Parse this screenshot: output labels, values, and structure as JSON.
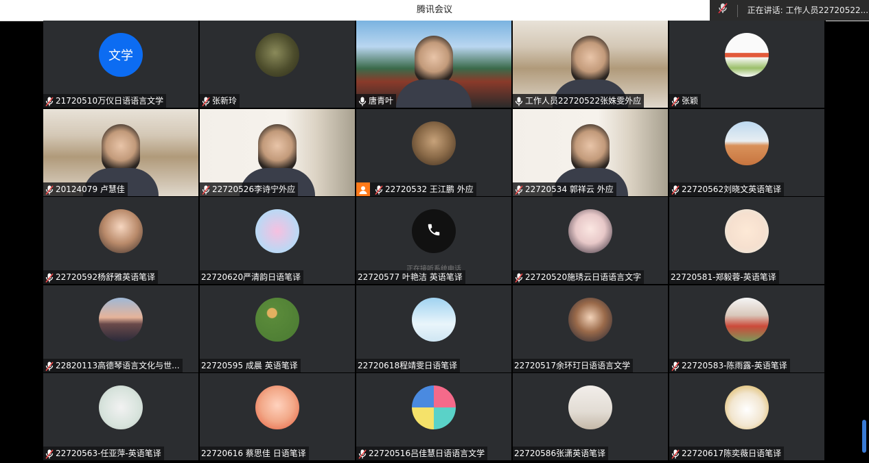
{
  "app": {
    "title": "腾讯会议"
  },
  "speaking": {
    "label": "正在讲话: 工作人员22720522..."
  },
  "tiles": [
    {
      "name": "21720510万仪日语语言文学",
      "mic": "muted",
      "avatar": "text",
      "avatar_text": "文学"
    },
    {
      "name": "张新玲",
      "mic": "muted",
      "avatar": "image",
      "theme": "olive"
    },
    {
      "name": "唐青叶",
      "mic": "on",
      "avatar": "video",
      "theme": "scenic"
    },
    {
      "name": "工作人员22720522张姝雯外应",
      "mic": "on",
      "avatar": "video",
      "theme": "shelf"
    },
    {
      "name": "张颖",
      "mic": "muted",
      "avatar": "image",
      "theme": "tulips"
    },
    {
      "name": "20124079 卢慧佳",
      "mic": "muted",
      "avatar": "video",
      "theme": "shelf"
    },
    {
      "name": "22720526李诗宁外应",
      "mic": "muted",
      "avatar": "video",
      "theme": "room"
    },
    {
      "name": "22720532 王江鹏 外应",
      "mic": "muted",
      "avatar": "image",
      "theme": "face",
      "phone_badge": true
    },
    {
      "name": "22720534 郭祥云 外应",
      "mic": "muted",
      "avatar": "video",
      "theme": "room"
    },
    {
      "name": "22720562刘晓文英语笔译",
      "mic": "muted",
      "avatar": "image",
      "theme": "desert"
    },
    {
      "name": "22720592杨舒雅英语笔译",
      "mic": "muted",
      "avatar": "image",
      "theme": "girl"
    },
    {
      "name": "22720620严清韵日语笔译",
      "mic": "none",
      "avatar": "image",
      "theme": "cartoon"
    },
    {
      "name": "22720577 叶艳洁 英语笔译",
      "mic": "none",
      "avatar": "phone",
      "theme": "phone",
      "status": "正在接听系统电话"
    },
    {
      "name": "22720520施琇云日语语言文字",
      "mic": "muted",
      "avatar": "image",
      "theme": "anime"
    },
    {
      "name": "22720581-郑毅蓉-英语笔译",
      "mic": "none",
      "avatar": "image",
      "theme": "boy"
    },
    {
      "name": "22820113高德琴语言文化与世...",
      "mic": "muted",
      "avatar": "image",
      "theme": "sunset"
    },
    {
      "name": "22720595 成晨 英语笔译",
      "mic": "none",
      "avatar": "image",
      "theme": "green"
    },
    {
      "name": "22720618程靖雯日语笔译",
      "mic": "none",
      "avatar": "image",
      "theme": "sky"
    },
    {
      "name": "22720517余环玎日语语言文学",
      "mic": "none",
      "avatar": "image",
      "theme": "person"
    },
    {
      "name": "22720583-陈雨露-英语笔译",
      "mic": "muted",
      "avatar": "image",
      "theme": "flowers"
    },
    {
      "name": "22720563-任亚萍-英语笔译",
      "mic": "muted",
      "avatar": "image",
      "theme": "dog"
    },
    {
      "name": "22720616 蔡思佳 日语笔译",
      "mic": "none",
      "avatar": "image",
      "theme": "kid"
    },
    {
      "name": "22720516吕佳慧日语语言文学",
      "mic": "muted",
      "avatar": "image",
      "theme": "colorful"
    },
    {
      "name": "22720586张潇英语笔译",
      "mic": "none",
      "avatar": "image",
      "theme": "wall"
    },
    {
      "name": "22720617陈奕薇日语笔译",
      "mic": "muted",
      "avatar": "image",
      "theme": "duck"
    }
  ]
}
